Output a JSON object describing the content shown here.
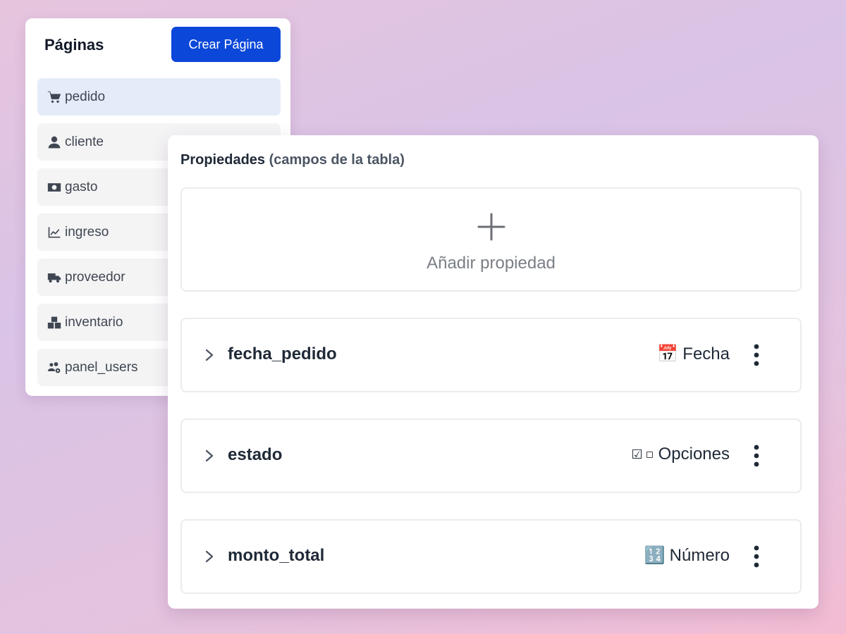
{
  "pages_panel": {
    "title": "Páginas",
    "create_button": "Crear Página",
    "items": [
      {
        "label": "pedido",
        "icon": "cart-icon",
        "active": true
      },
      {
        "label": "cliente",
        "icon": "user-icon",
        "active": false
      },
      {
        "label": "gasto",
        "icon": "money-icon",
        "active": false
      },
      {
        "label": "ingreso",
        "icon": "chart-line-icon",
        "active": false
      },
      {
        "label": "proveedor",
        "icon": "truck-icon",
        "active": false
      },
      {
        "label": "inventario",
        "icon": "boxes-icon",
        "active": false
      },
      {
        "label": "panel_users",
        "icon": "users-cog-icon",
        "active": false
      }
    ]
  },
  "properties_panel": {
    "heading": "Propiedades",
    "heading_sub": "(campos de la tabla)",
    "add_property_label": "Añadir propiedad",
    "properties": [
      {
        "name": "fecha_pedido",
        "type_label": "Fecha",
        "type_icon": "📅"
      },
      {
        "name": "estado",
        "type_label": "Opciones",
        "type_icon": "☑"
      },
      {
        "name": "monto_total",
        "type_label": "Número",
        "type_icon": "🔢"
      }
    ]
  },
  "colors": {
    "primary_button": "#0b47d9",
    "active_item_bg": "#e4ecf9"
  }
}
